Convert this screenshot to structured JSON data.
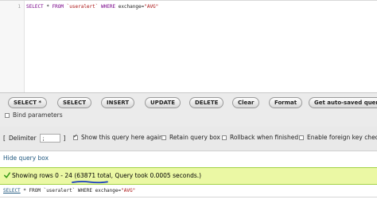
{
  "editor": {
    "line_number": "1",
    "tokens": {
      "select": "SELECT",
      "star": "*",
      "from": "FROM",
      "table": "`useralert`",
      "where": "WHERE",
      "condition": "exchange=",
      "value": "\"AVG\""
    }
  },
  "toolbar": {
    "buttons": [
      "SELECT *",
      "SELECT",
      "INSERT",
      "UPDATE",
      "DELETE",
      "Clear",
      "Format",
      "Get auto-saved query"
    ],
    "bind_parameters_label": "Bind parameters",
    "bind_parameters_checked": false
  },
  "options": {
    "delimiter_label": "Delimiter",
    "delimiter_open": "[",
    "delimiter_value": ";",
    "delimiter_close": "]",
    "show_query_label": "Show this query here again",
    "show_query_checked": true,
    "retain_query_label": "Retain query box",
    "retain_query_checked": false,
    "rollback_label": "Rollback when finished",
    "rollback_checked": false,
    "foreign_key_label": "Enable foreign key checks",
    "foreign_key_checked": false
  },
  "links": {
    "hide_query_box": "Hide query box"
  },
  "result": {
    "prefix": "Showing rows 0 - 24 (",
    "total": "63871 total",
    "suffix": ", Query took 0.0005 seconds.)"
  },
  "query_echo": {
    "select": "SELECT",
    "rest": " * FROM `useralert` WHERE exchange=",
    "value": "\"AVG\""
  },
  "colors": {
    "success_bg": "#ebf8a4",
    "success_border": "#a2d246",
    "annotation": "#1a3fbf"
  }
}
